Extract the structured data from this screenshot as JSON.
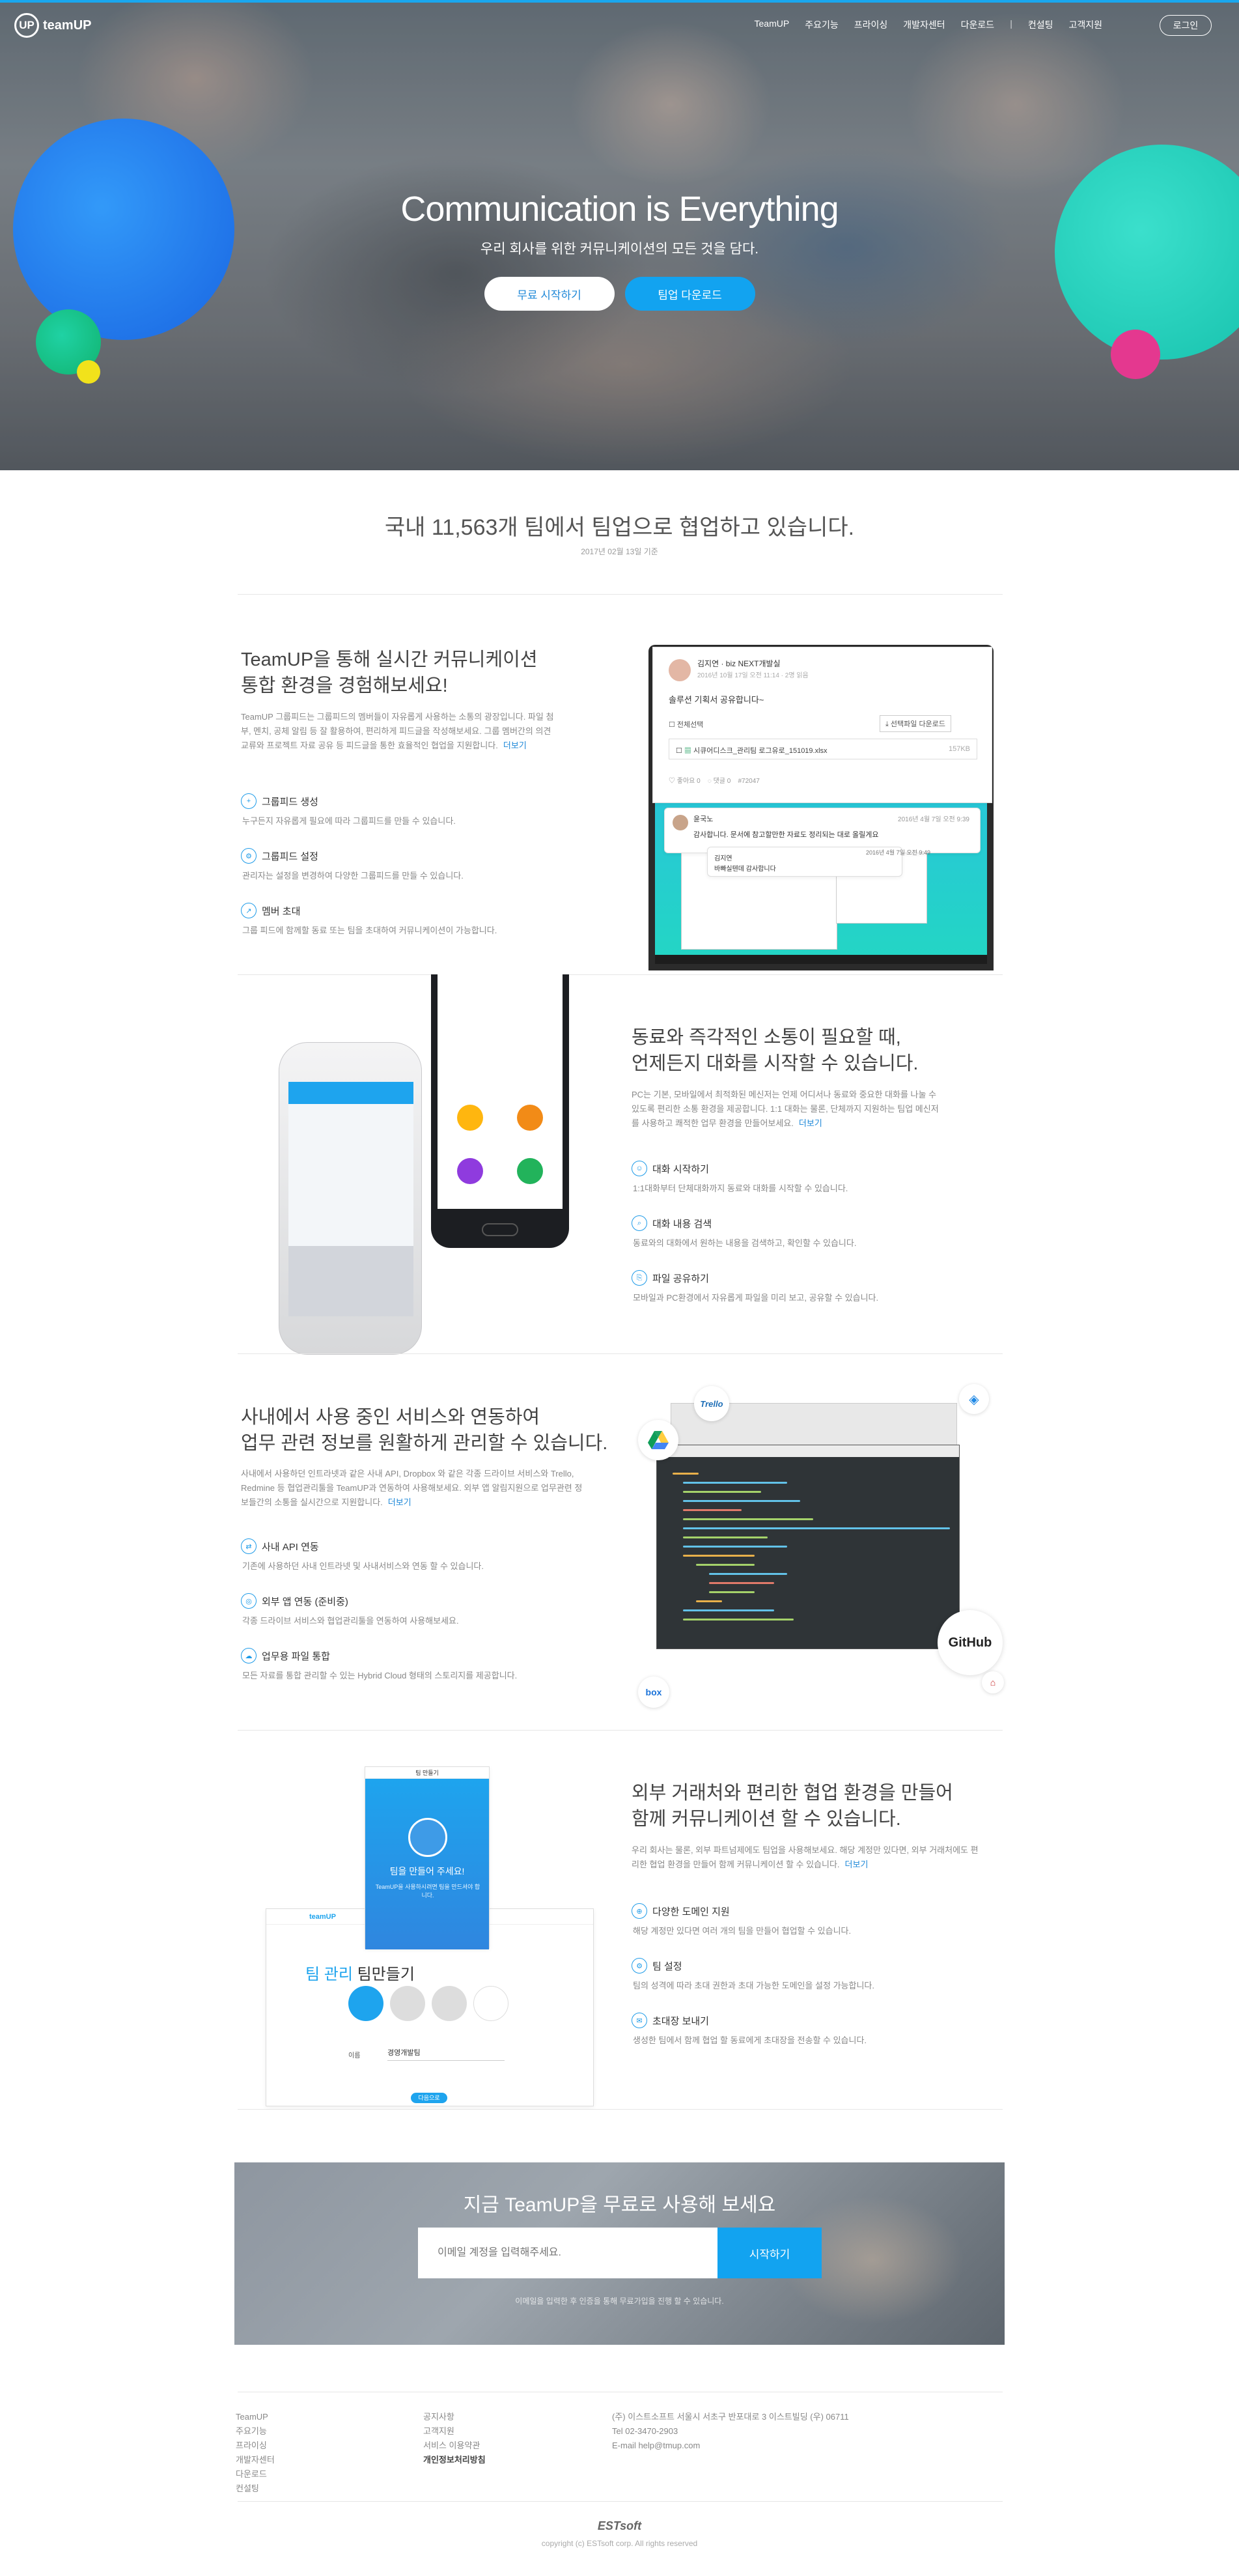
{
  "brand": {
    "logo_mark": "UP",
    "logo_text": "teamUP"
  },
  "nav": {
    "items": [
      "TeamUP",
      "주요기능",
      "프라이싱",
      "개발자센터",
      "다운로드",
      "|",
      "컨설팅",
      "고객지원"
    ],
    "login": "로그인"
  },
  "hero": {
    "title": "Communication is Everything",
    "subtitle": "우리 회사를 위한 커뮤니케이션의 모든 것을 담다.",
    "btn_free": "무료 시작하기",
    "btn_download": "팀업 다운로드"
  },
  "stats": {
    "title": "국내 11,563개 팀에서 팀업으로 협업하고 있습니다.",
    "date": "2017년 02월 13일 기준"
  },
  "sections": [
    {
      "title_1": "TeamUP을 통해 실시간 커뮤니케이션",
      "title_2": "통합 환경을 경험해보세요!",
      "desc": "TeamUP 그룹피드는 그룹피드의 멤버들이 자유롭게 사용하는 소통의 광장입니다. 파일 첨부, 멘치, 공체 알림 등 잘 활용하여, 편리하게 피드글을 작성해보세요. 그룹 멤버간의 의견 교류와 프로젝트 자료 공유 등 피드글을 통한 효율적인 협업을 지원합니다.",
      "more": "더보기",
      "items": [
        {
          "icon": "+",
          "title": "그룹피드 생성",
          "desc": "누구든지 자유롭게 필요에 따라 그룹피드를 만들 수 있습니다."
        },
        {
          "icon": "⚙",
          "title": "그룹피드 설정",
          "desc": "관리자는 설정을 변경하여 다양한 그룹피드를 만들 수 있습니다."
        },
        {
          "icon": "↗",
          "title": "멤버 초대",
          "desc": "그룹 피드에 함께할 동료 또는 팀을 초대하여 커뮤니케이션이 가능합니다."
        }
      ]
    },
    {
      "title_1": "동료와 즉각적인 소통이 필요할 때,",
      "title_2": "언제든지 대화를 시작할 수 있습니다.",
      "desc": "PC는 기본, 모바일에서 최적화된 메신저는 언제 어디서나 동료와 중요한 대화를 나눌 수 있도록 편리한 소통 환경을 제공합니다. 1:1 대화는 물론, 단체까지 지원하는 팀업 메신저를 사용하고 쾌적한 업무 환경을 만들어보세요.",
      "more": "더보기",
      "items": [
        {
          "icon": "☺",
          "title": "대화 시작하기",
          "desc": "1:1대화부터 단체대화까지 동료와 대화를 시작할 수 있습니다."
        },
        {
          "icon": "⌕",
          "title": "대화 내용 검색",
          "desc": "동료와의 대화에서 원하는 내용을 검색하고, 확인할 수 있습니다."
        },
        {
          "icon": "⎘",
          "title": "파일 공유하기",
          "desc": "모바일과 PC환경에서 자유롭게 파일을 미리 보고, 공유할 수 있습니다."
        }
      ]
    },
    {
      "title_1": "사내에서 사용 중인 서비스와 연동하여",
      "title_2": "업무 관련 정보를 원활하게 관리할 수 있습니다.",
      "desc": "사내에서 사용하던 인트라넷과 같은 사내 API, Dropbox 와 같은 각종 드라이브 서비스와 Trello, Redmine 등 협업관리툴을 TeamUP과 연동하여 사용해보세요. 외부 앱 알림지원으로 업무관련 정보들간의 소통을 실시간으로 지원합니다.",
      "more": "더보기",
      "items": [
        {
          "icon": "⇄",
          "title": "사내 API 연동",
          "desc": "기존에 사용하던 사내 인트라넷 및 사내서비스와 연동 할 수 있습니다."
        },
        {
          "icon": "◎",
          "title": "외부 앱 연동 (준비중)",
          "desc": "각종 드라이브 서비스와 협업관리툴을 연동하여 사용해보세요."
        },
        {
          "icon": "☁",
          "title": "업무용 파일 통합",
          "desc": "모든 자료를 통합 관리할 수 있는 Hybrid Cloud 형태의 스토리지를 제공합니다."
        }
      ]
    },
    {
      "title_1": "외부 거래처와 편리한 협업 환경을 만들어",
      "title_2": "함께 커뮤니케이션 할 수 있습니다.",
      "desc": "우리 회사는 물론, 외부 파트넘제에도 팀업을 사용해보세요. 해당 계정만 있다면, 외부 거래처에도 편리한 협업 환경을 만들어 함께 커뮤니케이션 할 수 있습니다.",
      "more": "더보기",
      "items": [
        {
          "icon": "⊕",
          "title": "다양한 도메인 지원",
          "desc": "해당 계정만 있다면 여러 개의 팀을 만들어 협업할 수 있습니다."
        },
        {
          "icon": "⚙",
          "title": "팀 설정",
          "desc": "팀의 성격에 따라 초대 권한과 초대 가능한 도메인을 설정 가능합니다."
        },
        {
          "icon": "✉",
          "title": "초대장 보내기",
          "desc": "생성한 팀에서 함께 협업 할 동료에게 초대장을 전송할 수 있습니다."
        }
      ]
    }
  ],
  "mock_feed": {
    "author": "김지연",
    "team": "biz NEXT개발실",
    "meta": "2016년 10월 17일 오전 11:14 · 2명 읽음",
    "text": "솔루션 기획서 공유합니다~",
    "select_all": "전체선택",
    "download": "선택파일 다운로드",
    "file": "시큐어디스크_관리팀 로그유로_151019.xlsx",
    "file_size": "157KB",
    "like": "좋아요 0",
    "comment": "댓글 0",
    "tag": "#72047",
    "chat_1_name": "윤국노",
    "chat_1_time": "2016년 4월 7일 오전 9:39",
    "chat_1_text": "감사합니다. 문서에 참고할만한 자료도 정리되는 대로 올릴게요",
    "chat_2_name": "김지연",
    "chat_2_text": "바빠실텐데 감사합니다",
    "chat_2_time": "2016년 4월 7일 오전 9:49"
  },
  "mock_services": {
    "trello": "Trello",
    "github": "GitHub",
    "box": "box"
  },
  "mock_team": {
    "popup_title": "팀 만들기",
    "popup_text": "팀을 만들어 주세요!",
    "popup_desc": "TeamUP을 사용하시려면 팀을 만드셔야 합니다.",
    "brand": "teamUP",
    "tabs": [
      "팀 관리",
      "팀만들기"
    ],
    "label": "이름",
    "value": "경영개발팀",
    "next": "다음으로"
  },
  "cta": {
    "title": "지금 TeamUP을 무료로 사용해 보세요",
    "placeholder": "이메일 계정을 입력해주세요.",
    "button": "시작하기",
    "note": "이메일을 입력한 후 인증을 통해 무료가입을 진행 할 수 있습니다."
  },
  "footer": {
    "col1": [
      "TeamUP",
      "주요기능",
      "프라이싱",
      "개발자센터",
      "다운로드",
      "컨설팅"
    ],
    "col2": [
      "공지사항",
      "고객지원",
      "서비스 이용약관",
      "개인정보처리방침"
    ],
    "col3": [
      "(주) 이스트소프트 서울시 서초구 반포대로 3 이스트빌딩 (우) 06711",
      "Tel 02-3470-2903",
      "E-mail help@tmup.com"
    ],
    "logo": "ESTsoft",
    "copyright": "copyright (c) ESTsoft corp. All rights reserved"
  },
  "colors": {
    "accent": "#12a3f0",
    "text": "#444444",
    "muted": "#888888"
  }
}
